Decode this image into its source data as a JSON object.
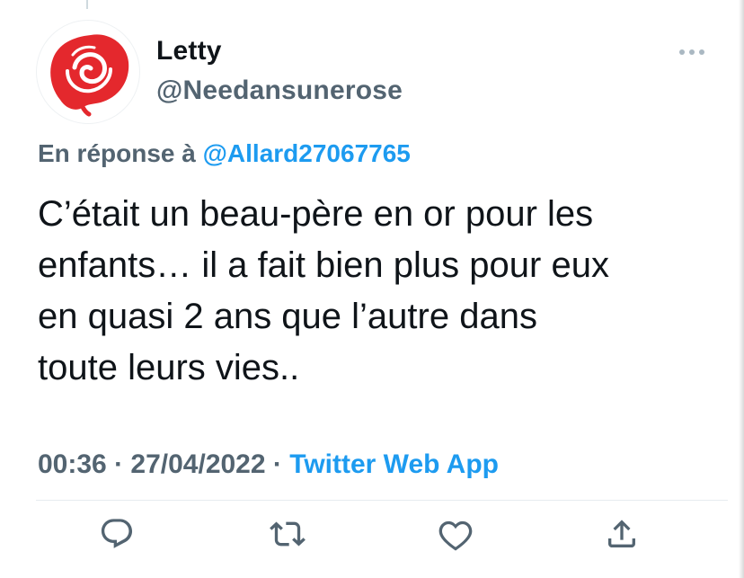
{
  "tweet": {
    "author": {
      "name": "Letty",
      "handle": "@Needansunerose",
      "avatar": "red-rose-logo"
    },
    "reply_prefix": "En réponse à",
    "reply_to": "@Allard27067765",
    "text": "C’était un beau-père en or pour les\nenfants… il a fait bien plus pour eux\nen quasi 2 ans que l’autre dans\ntoute leurs vies..",
    "time": "00:36",
    "separator": " · ",
    "date": "27/04/2022",
    "source": "Twitter Web App"
  },
  "actions": [
    {
      "name": "reply",
      "icon": "reply-icon"
    },
    {
      "name": "retweet",
      "icon": "retweet-icon"
    },
    {
      "name": "like",
      "icon": "heart-icon"
    },
    {
      "name": "share",
      "icon": "share-icon"
    }
  ],
  "colors": {
    "text": "#0f1419",
    "secondary": "#536471",
    "link": "#1d9bf0",
    "rose": "#e4282d"
  }
}
